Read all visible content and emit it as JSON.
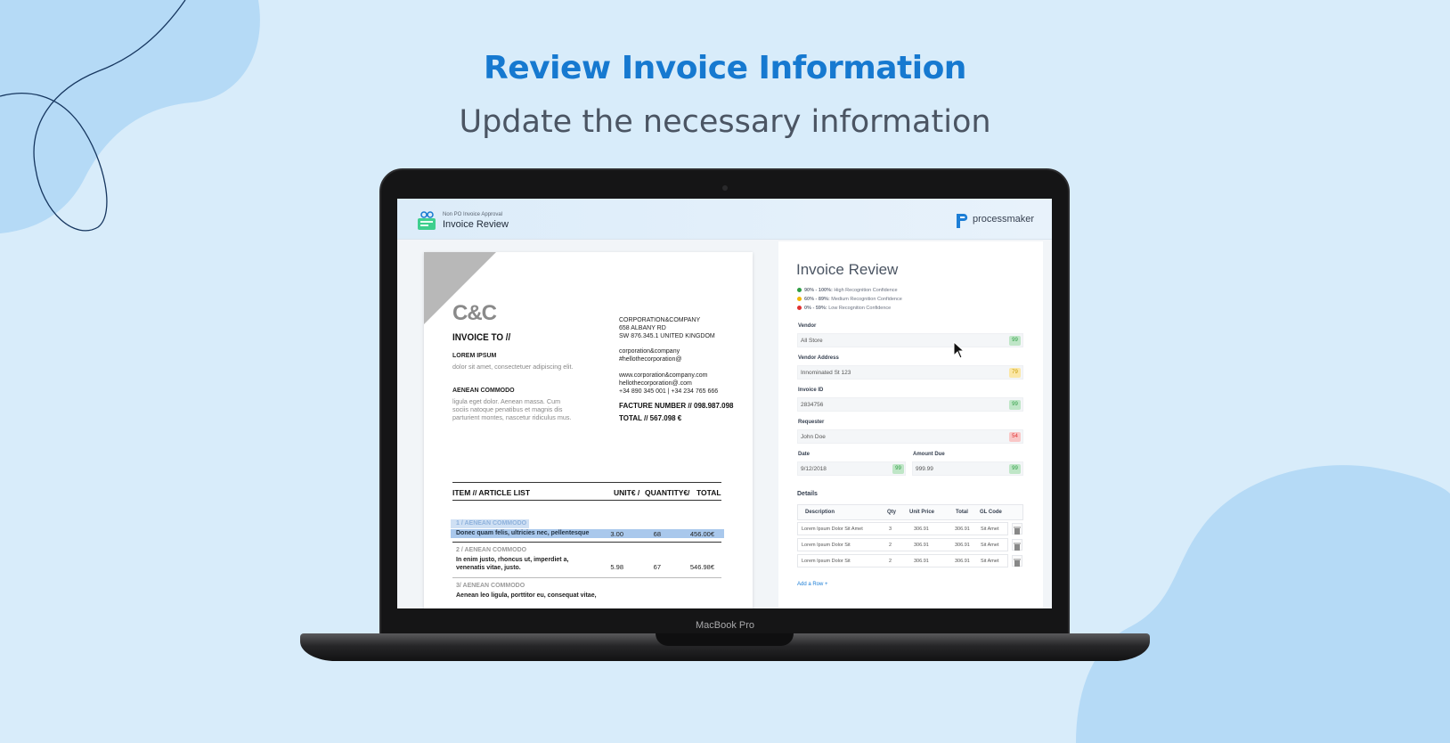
{
  "hero": {
    "title": "Review Invoice Information",
    "subtitle": "Update the necessary information"
  },
  "device": {
    "label": "MacBook Pro"
  },
  "app": {
    "kicker": "Non PO Invoice Approval",
    "title": "Invoice Review",
    "brand": "processmaker"
  },
  "invoice": {
    "brand": "C&C",
    "invoice_to": "INVOICE TO //",
    "party1_name": "LOREM IPSUM",
    "party1_text": "dolor sit amet, consectetuer adipiscing elit.",
    "party2_name": "AENEAN COMMODO",
    "party2_text": "ligula eget dolor. Aenean massa. Cum sociis natoque penatibus et magnis dis parturient montes, nascetur ridiculus mus.",
    "company": {
      "address_l1": "CORPORATION&COMPANY",
      "address_l2": "658 ALBANY RD",
      "address_l3": "SW 876.345.1 UNITED KINGDOM",
      "email_l1": "corporation&company",
      "email_l2": "#hellothecorporation@",
      "web_l1": "www.corporation&company.com",
      "web_l2": "hellothecorporation@.com",
      "web_l3": "+34 890 345 001 | +34 234 765 666"
    },
    "facture": "FACTURE NUMBER // 098.987.098",
    "total": "TOTAL // 567.098 €",
    "table_headers": {
      "item": "ITEM // ARTICLE LIST",
      "unit": "UNIT€ /",
      "qty": "QUANTITY€",
      "sep": "/",
      "total": "TOTAL"
    },
    "items": [
      {
        "title": "1 / AENEAN COMMODO",
        "desc": "Donec quam felis, ultricies nec, pellentesque",
        "unit": "3.00",
        "qty": "68",
        "total": "456.00€"
      },
      {
        "title": "2 / AENEAN COMMODO",
        "desc": "In enim justo, rhoncus ut, imperdiet a, venenatis vitae, justo.",
        "unit": "5.98",
        "qty": "67",
        "total": "546.98€"
      },
      {
        "title": "3/ AENEAN COMMODO",
        "desc": "Aenean leo ligula, porttitor eu, consequat vitae,",
        "unit": "",
        "qty": "",
        "total": ""
      }
    ]
  },
  "review": {
    "title": "Invoice Review",
    "legend": [
      {
        "range": "90% - 100%:",
        "text": "High Recognition Confidence",
        "color": "#2f9e44"
      },
      {
        "range": "60% - 89%:",
        "text": "Medium Recognition Confidence",
        "color": "#f2b705"
      },
      {
        "range": "0% - 59%:",
        "text": "Low Recognition Confidence",
        "color": "#e03131"
      }
    ],
    "fields": {
      "vendor": {
        "label": "Vendor",
        "value": "All Store",
        "score": "99"
      },
      "vendor_address": {
        "label": "Vendor Address",
        "value": "Innominated St 123",
        "score": "79"
      },
      "invoice_id": {
        "label": "Invoice ID",
        "value": "2834756",
        "score": "99"
      },
      "requester": {
        "label": "Requester",
        "value": "John Doe",
        "score": "54"
      },
      "date": {
        "label": "Date",
        "value": "9/12/2018",
        "score": "99"
      },
      "amount_due": {
        "label": "Amount Due",
        "value": "999.99",
        "score": "99"
      }
    },
    "details_label": "Details",
    "details_headers": {
      "description": "Description",
      "qty": "Qty",
      "unit_price": "Unit Price",
      "total": "Total",
      "gl_code": "GL Code"
    },
    "details_rows": [
      {
        "description": "Lorem Ipsum Dolor Sit Amet",
        "qty": "3",
        "unit_price": "306.91",
        "total": "306.91",
        "gl_code": "Sit Amet"
      },
      {
        "description": "Lorem Ipsum Dolor Sit",
        "qty": "2",
        "unit_price": "306.91",
        "total": "306.91",
        "gl_code": "Sit Amet"
      },
      {
        "description": "Lorem Ipsum Dolor Sit",
        "qty": "2",
        "unit_price": "306.91",
        "total": "306.91",
        "gl_code": "Sit Amet"
      }
    ],
    "add_row": "Add a Row +"
  }
}
